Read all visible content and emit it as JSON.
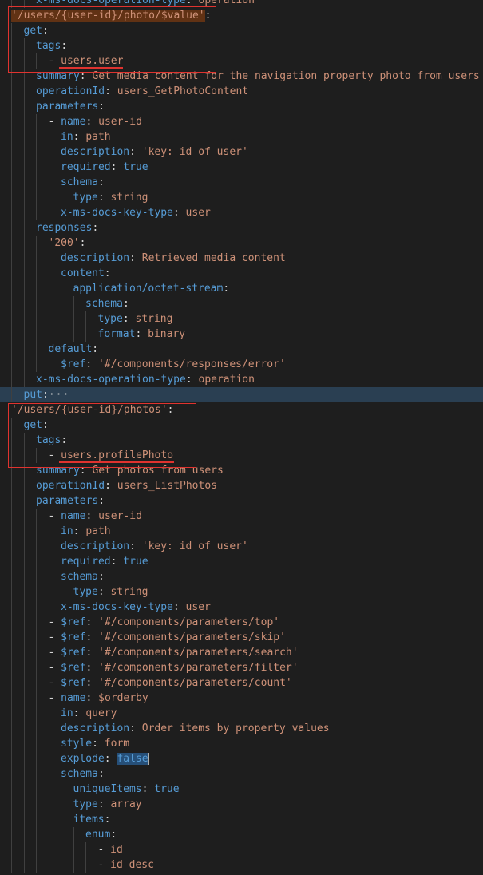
{
  "lines": [
    {
      "indent": 2,
      "parts": [
        {
          "t": "x-ms-docs-operation-type",
          "c": "key"
        },
        {
          "t": ": ",
          "c": "punc"
        },
        {
          "t": "operation",
          "c": "str"
        }
      ]
    },
    {
      "indent": 0,
      "parts": [
        {
          "t": "'/users/{user-id}/photo/$value'",
          "c": "str",
          "bg": "selbg"
        },
        {
          "t": ":",
          "c": "punc"
        }
      ]
    },
    {
      "indent": 1,
      "parts": [
        {
          "t": "get",
          "c": "key"
        },
        {
          "t": ":",
          "c": "punc"
        }
      ]
    },
    {
      "indent": 2,
      "parts": [
        {
          "t": "tags",
          "c": "key"
        },
        {
          "t": ":",
          "c": "punc"
        }
      ]
    },
    {
      "indent": 3,
      "parts": [
        {
          "t": "- ",
          "c": "punc"
        },
        {
          "t": "users.user",
          "c": "str"
        }
      ]
    },
    {
      "indent": 2,
      "parts": [
        {
          "t": "summary",
          "c": "key"
        },
        {
          "t": ": ",
          "c": "punc"
        },
        {
          "t": "Get media content for the navigation property photo from users",
          "c": "str"
        }
      ]
    },
    {
      "indent": 2,
      "parts": [
        {
          "t": "operationId",
          "c": "key"
        },
        {
          "t": ": ",
          "c": "punc"
        },
        {
          "t": "users_GetPhotoContent",
          "c": "str"
        }
      ]
    },
    {
      "indent": 2,
      "parts": [
        {
          "t": "parameters",
          "c": "key"
        },
        {
          "t": ":",
          "c": "punc"
        }
      ]
    },
    {
      "indent": 3,
      "parts": [
        {
          "t": "- ",
          "c": "punc"
        },
        {
          "t": "name",
          "c": "key"
        },
        {
          "t": ": ",
          "c": "punc"
        },
        {
          "t": "user-id",
          "c": "str"
        }
      ]
    },
    {
      "indent": 4,
      "parts": [
        {
          "t": "in",
          "c": "key"
        },
        {
          "t": ": ",
          "c": "punc"
        },
        {
          "t": "path",
          "c": "str"
        }
      ]
    },
    {
      "indent": 4,
      "parts": [
        {
          "t": "description",
          "c": "key"
        },
        {
          "t": ": ",
          "c": "punc"
        },
        {
          "t": "'key: id of user'",
          "c": "str"
        }
      ]
    },
    {
      "indent": 4,
      "parts": [
        {
          "t": "required",
          "c": "key"
        },
        {
          "t": ": ",
          "c": "punc"
        },
        {
          "t": "true",
          "c": "kw"
        }
      ]
    },
    {
      "indent": 4,
      "parts": [
        {
          "t": "schema",
          "c": "key"
        },
        {
          "t": ":",
          "c": "punc"
        }
      ]
    },
    {
      "indent": 5,
      "parts": [
        {
          "t": "type",
          "c": "key"
        },
        {
          "t": ": ",
          "c": "punc"
        },
        {
          "t": "string",
          "c": "str"
        }
      ]
    },
    {
      "indent": 4,
      "parts": [
        {
          "t": "x-ms-docs-key-type",
          "c": "key"
        },
        {
          "t": ": ",
          "c": "punc"
        },
        {
          "t": "user",
          "c": "str"
        }
      ]
    },
    {
      "indent": 2,
      "parts": [
        {
          "t": "responses",
          "c": "key"
        },
        {
          "t": ":",
          "c": "punc"
        }
      ]
    },
    {
      "indent": 3,
      "parts": [
        {
          "t": "'200'",
          "c": "str"
        },
        {
          "t": ":",
          "c": "punc"
        }
      ]
    },
    {
      "indent": 4,
      "parts": [
        {
          "t": "description",
          "c": "key"
        },
        {
          "t": ": ",
          "c": "punc"
        },
        {
          "t": "Retrieved media content",
          "c": "str"
        }
      ]
    },
    {
      "indent": 4,
      "parts": [
        {
          "t": "content",
          "c": "key"
        },
        {
          "t": ":",
          "c": "punc"
        }
      ]
    },
    {
      "indent": 5,
      "parts": [
        {
          "t": "application/octet-stream",
          "c": "key"
        },
        {
          "t": ":",
          "c": "punc"
        }
      ]
    },
    {
      "indent": 6,
      "parts": [
        {
          "t": "schema",
          "c": "key"
        },
        {
          "t": ":",
          "c": "punc"
        }
      ]
    },
    {
      "indent": 7,
      "parts": [
        {
          "t": "type",
          "c": "key"
        },
        {
          "t": ": ",
          "c": "punc"
        },
        {
          "t": "string",
          "c": "str"
        }
      ]
    },
    {
      "indent": 7,
      "parts": [
        {
          "t": "format",
          "c": "key"
        },
        {
          "t": ": ",
          "c": "punc"
        },
        {
          "t": "binary",
          "c": "str"
        }
      ]
    },
    {
      "indent": 3,
      "parts": [
        {
          "t": "default",
          "c": "key"
        },
        {
          "t": ":",
          "c": "punc"
        }
      ]
    },
    {
      "indent": 4,
      "parts": [
        {
          "t": "$ref",
          "c": "key"
        },
        {
          "t": ": ",
          "c": "punc"
        },
        {
          "t": "'#/components/responses/error'",
          "c": "str"
        }
      ]
    },
    {
      "indent": 2,
      "parts": [
        {
          "t": "x-ms-docs-operation-type",
          "c": "key"
        },
        {
          "t": ": ",
          "c": "punc"
        },
        {
          "t": "operation",
          "c": "str"
        }
      ]
    },
    {
      "indent": 1,
      "hl": true,
      "parts": [
        {
          "t": "put",
          "c": "key"
        },
        {
          "t": ":",
          "c": "punc"
        },
        {
          "t": "···",
          "c": "fold"
        }
      ]
    },
    {
      "indent": 0,
      "parts": [
        {
          "t": "'/users/{user-id}/photos'",
          "c": "str"
        },
        {
          "t": ":",
          "c": "punc"
        }
      ]
    },
    {
      "indent": 1,
      "parts": [
        {
          "t": "get",
          "c": "key"
        },
        {
          "t": ":",
          "c": "punc"
        }
      ]
    },
    {
      "indent": 2,
      "parts": [
        {
          "t": "tags",
          "c": "key"
        },
        {
          "t": ":",
          "c": "punc"
        }
      ]
    },
    {
      "indent": 3,
      "parts": [
        {
          "t": "- ",
          "c": "punc"
        },
        {
          "t": "users.profilePhoto",
          "c": "str"
        }
      ]
    },
    {
      "indent": 2,
      "parts": [
        {
          "t": "summary",
          "c": "key"
        },
        {
          "t": ": ",
          "c": "punc"
        },
        {
          "t": "Get photos from users",
          "c": "str"
        }
      ]
    },
    {
      "indent": 2,
      "parts": [
        {
          "t": "operationId",
          "c": "key"
        },
        {
          "t": ": ",
          "c": "punc"
        },
        {
          "t": "users_ListPhotos",
          "c": "str"
        }
      ]
    },
    {
      "indent": 2,
      "parts": [
        {
          "t": "parameters",
          "c": "key"
        },
        {
          "t": ":",
          "c": "punc"
        }
      ]
    },
    {
      "indent": 3,
      "parts": [
        {
          "t": "- ",
          "c": "punc"
        },
        {
          "t": "name",
          "c": "key"
        },
        {
          "t": ": ",
          "c": "punc"
        },
        {
          "t": "user-id",
          "c": "str"
        }
      ]
    },
    {
      "indent": 4,
      "parts": [
        {
          "t": "in",
          "c": "key"
        },
        {
          "t": ": ",
          "c": "punc"
        },
        {
          "t": "path",
          "c": "str"
        }
      ]
    },
    {
      "indent": 4,
      "parts": [
        {
          "t": "description",
          "c": "key"
        },
        {
          "t": ": ",
          "c": "punc"
        },
        {
          "t": "'key: id of user'",
          "c": "str"
        }
      ]
    },
    {
      "indent": 4,
      "parts": [
        {
          "t": "required",
          "c": "key"
        },
        {
          "t": ": ",
          "c": "punc"
        },
        {
          "t": "true",
          "c": "kw"
        }
      ]
    },
    {
      "indent": 4,
      "parts": [
        {
          "t": "schema",
          "c": "key"
        },
        {
          "t": ":",
          "c": "punc"
        }
      ]
    },
    {
      "indent": 5,
      "parts": [
        {
          "t": "type",
          "c": "key"
        },
        {
          "t": ": ",
          "c": "punc"
        },
        {
          "t": "string",
          "c": "str"
        }
      ]
    },
    {
      "indent": 4,
      "parts": [
        {
          "t": "x-ms-docs-key-type",
          "c": "key"
        },
        {
          "t": ": ",
          "c": "punc"
        },
        {
          "t": "user",
          "c": "str"
        }
      ]
    },
    {
      "indent": 3,
      "parts": [
        {
          "t": "- ",
          "c": "punc"
        },
        {
          "t": "$ref",
          "c": "key"
        },
        {
          "t": ": ",
          "c": "punc"
        },
        {
          "t": "'#/components/parameters/top'",
          "c": "str"
        }
      ]
    },
    {
      "indent": 3,
      "parts": [
        {
          "t": "- ",
          "c": "punc"
        },
        {
          "t": "$ref",
          "c": "key"
        },
        {
          "t": ": ",
          "c": "punc"
        },
        {
          "t": "'#/components/parameters/skip'",
          "c": "str"
        }
      ]
    },
    {
      "indent": 3,
      "parts": [
        {
          "t": "- ",
          "c": "punc"
        },
        {
          "t": "$ref",
          "c": "key"
        },
        {
          "t": ": ",
          "c": "punc"
        },
        {
          "t": "'#/components/parameters/search'",
          "c": "str"
        }
      ]
    },
    {
      "indent": 3,
      "parts": [
        {
          "t": "- ",
          "c": "punc"
        },
        {
          "t": "$ref",
          "c": "key"
        },
        {
          "t": ": ",
          "c": "punc"
        },
        {
          "t": "'#/components/parameters/filter'",
          "c": "str"
        }
      ]
    },
    {
      "indent": 3,
      "parts": [
        {
          "t": "- ",
          "c": "punc"
        },
        {
          "t": "$ref",
          "c": "key"
        },
        {
          "t": ": ",
          "c": "punc"
        },
        {
          "t": "'#/components/parameters/count'",
          "c": "str"
        }
      ]
    },
    {
      "indent": 3,
      "parts": [
        {
          "t": "- ",
          "c": "punc"
        },
        {
          "t": "name",
          "c": "key"
        },
        {
          "t": ": ",
          "c": "punc"
        },
        {
          "t": "$orderby",
          "c": "str"
        }
      ]
    },
    {
      "indent": 4,
      "parts": [
        {
          "t": "in",
          "c": "key"
        },
        {
          "t": ": ",
          "c": "punc"
        },
        {
          "t": "query",
          "c": "str"
        }
      ]
    },
    {
      "indent": 4,
      "parts": [
        {
          "t": "description",
          "c": "key"
        },
        {
          "t": ": ",
          "c": "punc"
        },
        {
          "t": "Order items by property values",
          "c": "str"
        }
      ]
    },
    {
      "indent": 4,
      "parts": [
        {
          "t": "style",
          "c": "key"
        },
        {
          "t": ": ",
          "c": "punc"
        },
        {
          "t": "form",
          "c": "str"
        }
      ]
    },
    {
      "indent": 4,
      "cursor": true,
      "parts": [
        {
          "t": "explode",
          "c": "key"
        },
        {
          "t": ": ",
          "c": "punc"
        },
        {
          "t": "false",
          "c": "kw",
          "bg": "sel"
        }
      ]
    },
    {
      "indent": 4,
      "parts": [
        {
          "t": "schema",
          "c": "key"
        },
        {
          "t": ":",
          "c": "punc"
        }
      ]
    },
    {
      "indent": 5,
      "parts": [
        {
          "t": "uniqueItems",
          "c": "key"
        },
        {
          "t": ": ",
          "c": "punc"
        },
        {
          "t": "true",
          "c": "kw"
        }
      ]
    },
    {
      "indent": 5,
      "parts": [
        {
          "t": "type",
          "c": "key"
        },
        {
          "t": ": ",
          "c": "punc"
        },
        {
          "t": "array",
          "c": "str"
        }
      ]
    },
    {
      "indent": 5,
      "parts": [
        {
          "t": "items",
          "c": "key"
        },
        {
          "t": ":",
          "c": "punc"
        }
      ]
    },
    {
      "indent": 6,
      "parts": [
        {
          "t": "enum",
          "c": "key"
        },
        {
          "t": ":",
          "c": "punc"
        }
      ]
    },
    {
      "indent": 7,
      "parts": [
        {
          "t": "- ",
          "c": "punc"
        },
        {
          "t": "id",
          "c": "str"
        }
      ]
    },
    {
      "indent": 7,
      "parts": [
        {
          "t": "- ",
          "c": "punc"
        },
        {
          "t": "id desc",
          "c": "str"
        }
      ]
    }
  ]
}
